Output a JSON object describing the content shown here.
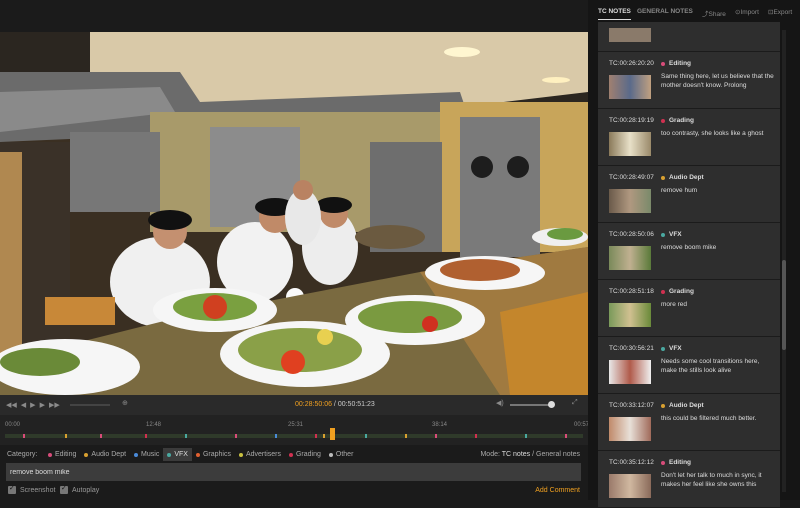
{
  "video": {
    "scene": "restaurant-kitchen-frame"
  },
  "transport": {
    "current_time": "00:28:50:06",
    "separator": " / ",
    "duration": "00:50:51:23",
    "controls": [
      "skip-back-icon",
      "step-back-icon",
      "play-icon",
      "step-forward-icon",
      "skip-forward-icon",
      "zoom-icon",
      "volume-icon",
      "fullscreen-icon"
    ]
  },
  "timeline": {
    "ticks": [
      "00:00",
      "12:48",
      "25:31",
      "38:14",
      "00:57"
    ]
  },
  "category_bar": {
    "label": "Category:",
    "categories": [
      {
        "name": "Editing",
        "color": "#d84c7a"
      },
      {
        "name": "Audio Dept",
        "color": "#d8a030"
      },
      {
        "name": "Music",
        "color": "#4a8ad8"
      },
      {
        "name": "VFX",
        "color": "#4aa8a0"
      },
      {
        "name": "Graphics",
        "color": "#e06030"
      },
      {
        "name": "Advertisers",
        "color": "#c8c040"
      },
      {
        "name": "Grading",
        "color": "#d03050"
      },
      {
        "name": "Other",
        "color": "#bbbbbb"
      }
    ],
    "selected": "VFX",
    "mode_label": "Mode:",
    "mode_active": "TC notes",
    "mode_sep": " / ",
    "mode_other": "General notes"
  },
  "note_input": {
    "value": "remove boom mike"
  },
  "options": {
    "screenshot": "Screenshot",
    "autoplay": "Autoplay",
    "add_comment": "Add Comment"
  },
  "panel": {
    "tabs": [
      "TC NOTES",
      "GENERAL NOTES"
    ],
    "actions": [
      "Share",
      "Import",
      "Export"
    ],
    "notes": [
      {
        "tc": "TC:00:26:20:20",
        "category": "Editing",
        "color": "#d84c7a",
        "text": "Same thing here, let us believe that the mother doesn't know. Prolong"
      },
      {
        "tc": "TC:00:28:19:19",
        "category": "Grading",
        "color": "#d03050",
        "text": "too contrasty, she looks like a ghost"
      },
      {
        "tc": "TC:00:28:49:07",
        "category": "Audio Dept",
        "color": "#d8a030",
        "text": "remove hum"
      },
      {
        "tc": "TC:00:28:50:06",
        "category": "VFX",
        "color": "#4aa8a0",
        "text": "remove boom mike"
      },
      {
        "tc": "TC:00:28:51:18",
        "category": "Grading",
        "color": "#d03050",
        "text": "more red"
      },
      {
        "tc": "TC:00:30:56:21",
        "category": "VFX",
        "color": "#4aa8a0",
        "text": "Needs some cool transitions here, make the stills look alive"
      },
      {
        "tc": "TC:00:33:12:07",
        "category": "Audio Dept",
        "color": "#d8a030",
        "text": "this could be filtered much better."
      },
      {
        "tc": "TC:00:35:12:12",
        "category": "Editing",
        "color": "#d84c7a",
        "text": "Don't let her talk to much in sync, it makes her feel like she owns this"
      }
    ]
  }
}
